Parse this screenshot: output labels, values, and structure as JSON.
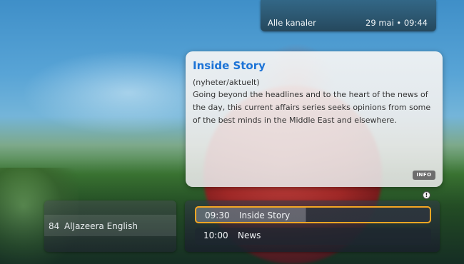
{
  "header": {
    "channel_filter": "Alle kanaler",
    "datetime": "29 mai • 09:44"
  },
  "info_card": {
    "title": "Inside Story",
    "genre": "(nyheter/aktuelt)",
    "description": "Going beyond the headlines and to the heart of the news of the day, this current affairs series seeks opinions from some of the best minds in the Middle East and elsewhere.",
    "info_button_label": "INFO"
  },
  "channel": {
    "number": "84",
    "name": "AlJazeera English"
  },
  "programs": [
    {
      "time": "09:30",
      "title": "Inside Story",
      "progress": 0.47,
      "selected": true
    },
    {
      "time": "10:00",
      "title": "News",
      "selected": false
    }
  ],
  "colors": {
    "accent_selection": "#f5a623",
    "title_blue": "#1c73d6"
  },
  "icons": {
    "alert": "alert-icon"
  }
}
